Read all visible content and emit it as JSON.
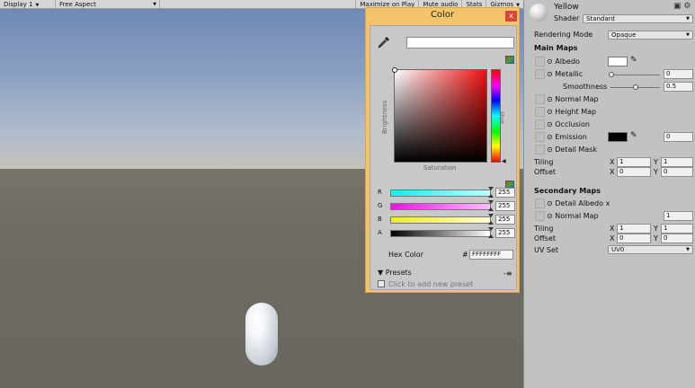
{
  "game_view": {
    "display": "Display 1",
    "aspect": "Free Aspect",
    "maximize": "Maximize on Play",
    "mute": "Mute audio",
    "stats": "Stats",
    "gizmos": "Gizmos",
    "sky_color": "#8aa0c2",
    "ground_color": "#6e6a64"
  },
  "color_picker": {
    "title": "Color",
    "close": "x",
    "brightness_label": "Brightness",
    "hue_label": "Hue",
    "saturation_label": "Saturation",
    "channels": [
      {
        "label": "R",
        "value": "255"
      },
      {
        "label": "G",
        "value": "255"
      },
      {
        "label": "B",
        "value": "255"
      },
      {
        "label": "A",
        "value": "255"
      }
    ],
    "hex_label": "Hex Color",
    "hex_hash": "#",
    "hex_value": "FFFFFFFF",
    "presets_label": "Presets",
    "presets_menu": "-≡",
    "add_preset": "Click to add new preset",
    "frame_color": "#f4c46a"
  },
  "inspector": {
    "material_name": "Yellow",
    "shader_label": "Shader",
    "shader_value": "Standard",
    "rendering_mode_label": "Rendering Mode",
    "rendering_mode_value": "Opaque",
    "main_maps": "Main Maps",
    "albedo": "Albedo",
    "metallic": "Metallic",
    "metallic_value": "0",
    "smoothness": "Smoothness",
    "smoothness_value": "0.5",
    "normal_map": "Normal Map",
    "height_map": "Height Map",
    "occlusion": "Occlusion",
    "emission": "Emission",
    "emission_value": "0",
    "detail_mask": "Detail Mask",
    "tiling": "Tiling",
    "offset": "Offset",
    "x_label": "X",
    "y_label": "Y",
    "tiling_x": "1",
    "tiling_y": "1",
    "offset_x": "0",
    "offset_y": "0",
    "secondary_maps": "Secondary Maps",
    "detail_albedo": "Detail Albedo x",
    "normal_map2": "Normal Map",
    "normal_map2_value": "1",
    "tiling2_x": "1",
    "tiling2_y": "1",
    "offset2_x": "0",
    "offset2_y": "0",
    "uv_set_label": "UV Set",
    "uv_set_value": "UV0"
  }
}
